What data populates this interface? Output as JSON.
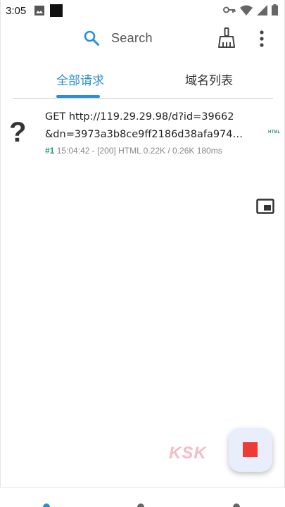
{
  "status_bar": {
    "time": "3:05",
    "icons": [
      "image-icon",
      "app-square-icon",
      "vpn-key-icon",
      "wifi-icon",
      "signal-icon",
      "battery-icon"
    ]
  },
  "toolbar": {
    "search_label": "Search",
    "icons": [
      "search-icon",
      "broom-icon",
      "more-vert-icon"
    ]
  },
  "tabs": [
    {
      "label": "全部请求",
      "selected": true
    },
    {
      "label": "域名列表",
      "selected": false
    }
  ],
  "request": {
    "icon": "question-mark-icon",
    "line1": "GET http://119.29.29.98/d?id=39662",
    "line2": "&dn=3973a3b8ce9ff2186d38afa974…",
    "id": "#1",
    "meta": "15:04:42 - [200] HTML 0.22K / 0.26K  180ms",
    "type_badge": "HTML"
  },
  "floating": {
    "pip_icon": "picture-in-picture-icon",
    "fab_icon": "stop-icon"
  },
  "watermark": "KSK",
  "colors": {
    "accent": "#2c8fd6",
    "success": "#2a9b6a",
    "stop": "#ee3b34"
  }
}
